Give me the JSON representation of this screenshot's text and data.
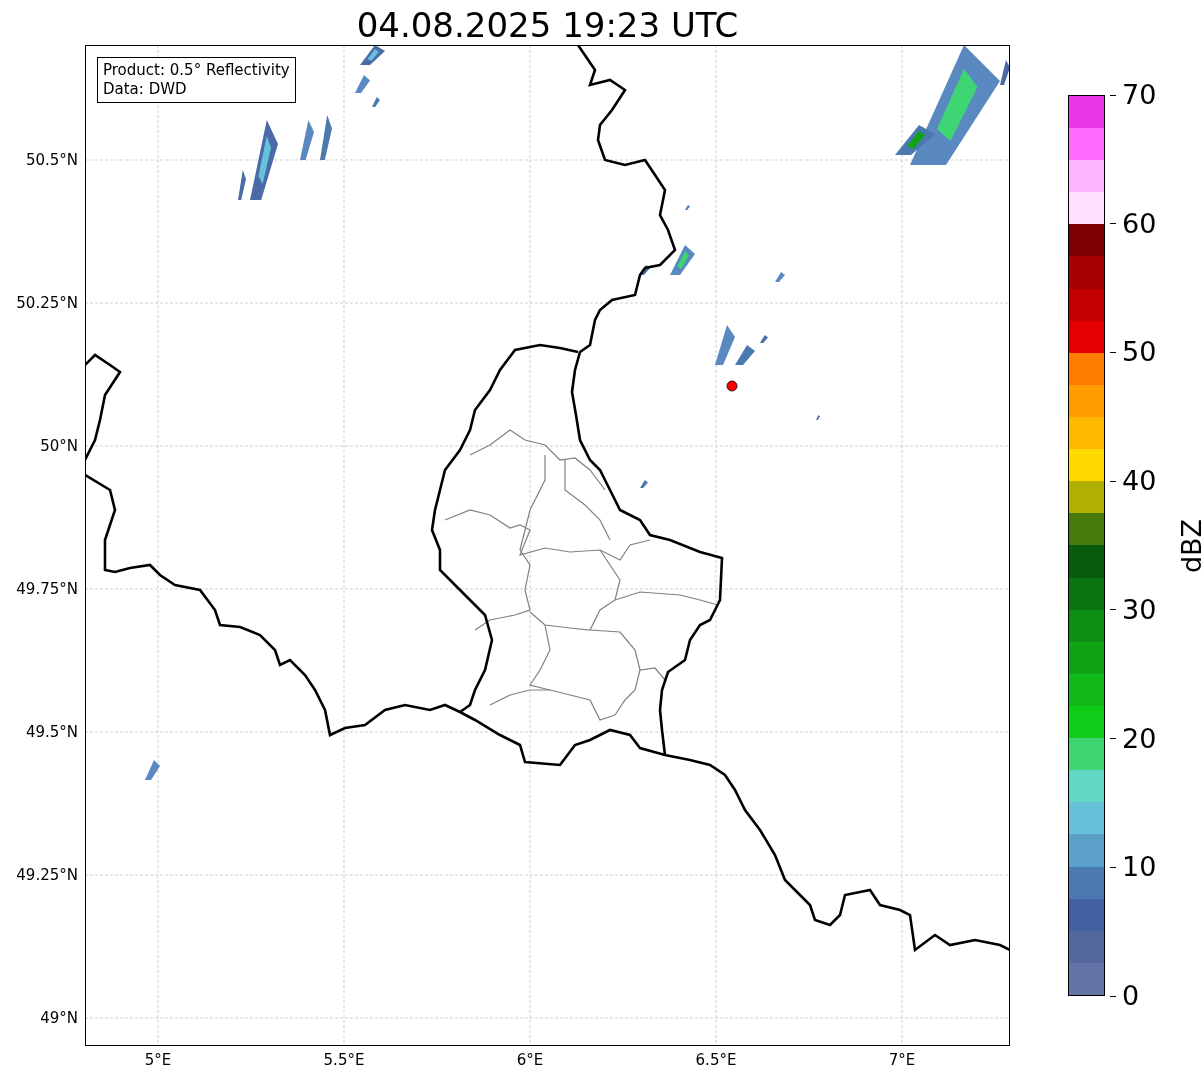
{
  "title": "04.08.2025 19:23 UTC",
  "legend": [
    "Product: 0.5° Reflectivity",
    "Data: DWD"
  ],
  "lat_ticks": [
    "50.5°N",
    "50.25°N",
    "50°N",
    "49.75°N",
    "49.5°N",
    "49.25°N",
    "49°N"
  ],
  "lon_ticks": [
    "5°E",
    "5.5°E",
    "6°E",
    "6.5°E",
    "7°E"
  ],
  "colorbar": {
    "label": "dBZ",
    "ticks": [
      "70",
      "60",
      "50",
      "40",
      "30",
      "20",
      "10",
      "0"
    ],
    "bins": [
      {
        "color": "#6574a6"
      },
      {
        "color": "#5468a0"
      },
      {
        "color": "#4460a2"
      },
      {
        "color": "#4a79b0"
      },
      {
        "color": "#5aa0c8"
      },
      {
        "color": "#66c2db"
      },
      {
        "color": "#60d8c4"
      },
      {
        "color": "#3ed672"
      },
      {
        "color": "#10cc18"
      },
      {
        "color": "#10b818"
      },
      {
        "color": "#10a414"
      },
      {
        "color": "#0e8e14"
      },
      {
        "color": "#0a7510"
      },
      {
        "color": "#085c0c"
      },
      {
        "color": "#467a0a"
      },
      {
        "color": "#b0b002"
      },
      {
        "color": "#ffd800"
      },
      {
        "color": "#ffb800"
      },
      {
        "color": "#ff9c00"
      },
      {
        "color": "#ff7c00"
      },
      {
        "color": "#e40000"
      },
      {
        "color": "#c40000"
      },
      {
        "color": "#a40000"
      },
      {
        "color": "#7c0000"
      },
      {
        "color": "#ffe0ff"
      },
      {
        "color": "#ffb4ff"
      },
      {
        "color": "#ff6cff"
      },
      {
        "color": "#e838e8"
      }
    ]
  }
}
